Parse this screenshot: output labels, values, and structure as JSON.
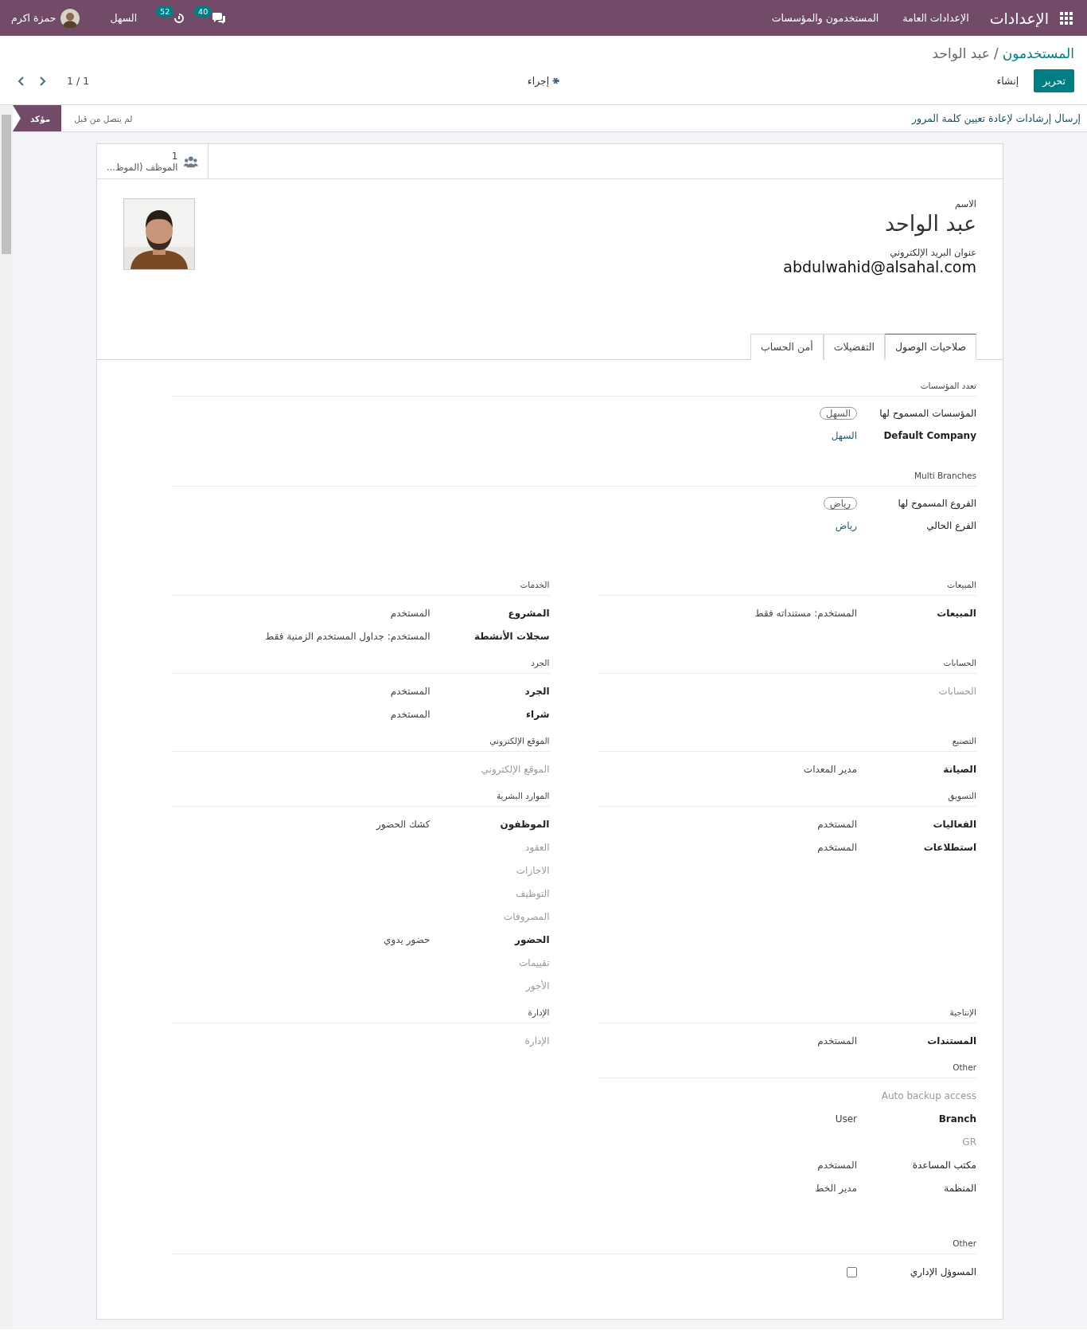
{
  "navbar": {
    "app_title": "الإعدادات",
    "menu": [
      "الإعدادات العامة",
      "المستخدمون والمؤسسات"
    ],
    "messages_count": "40",
    "activities_count": "52",
    "company": "السهل",
    "user": "حمزة اكرم"
  },
  "breadcrumb": {
    "parent": "المستخدمون",
    "separator": "/",
    "current": "عبد الواحد"
  },
  "buttons": [
    {
      "label": "تحرير",
      "kind": "primary"
    },
    {
      "label": "إنشاء",
      "kind": "secondary"
    }
  ],
  "action_menu": "إجراء",
  "pager": "1 / 1",
  "header_button": "إرسال إرشادات لإعادة تعيين كلمة المرور",
  "statuses": [
    {
      "label": "لم يتصل من قبل",
      "selected": false
    },
    {
      "label": "مؤكد",
      "selected": true
    }
  ],
  "smart_button": {
    "count": "1",
    "label": "الموظف (الموظ..."
  },
  "name_label": "الاسم",
  "name": "عبد الواحد",
  "email_label": "عنوان البريد الإلكتروني",
  "email": "abdulwahid@alsahal.com",
  "tabs": [
    {
      "label": "صلاحيات الوصول",
      "selected": true
    },
    {
      "label": "التفضيلات",
      "selected": false
    },
    {
      "label": "أمن الحساب",
      "selected": false
    }
  ],
  "company_groups": [
    {
      "title": "تعدد المؤسسات",
      "fields": [
        {
          "label": "المؤسسات المسموح لها",
          "kind": "tag",
          "value": "السهل",
          "bold": false
        },
        {
          "label": "Default Company",
          "kind": "link",
          "value": "السهل",
          "bold": true
        }
      ]
    },
    {
      "title": "Multi Branches",
      "fields": [
        {
          "label": "الفروع المسموح لها",
          "kind": "tag",
          "value": "رياض",
          "bold": false
        },
        {
          "label": "الفرع الحالي",
          "kind": "link",
          "value": "رياض",
          "bold": false
        }
      ]
    }
  ],
  "app_groups": [
    {
      "title": "المبيعات",
      "fields": [
        {
          "label": "المبيعات",
          "kind": "text",
          "value": "المستخدم: مستنداته فقط",
          "bold": true
        }
      ]
    },
    {
      "title": "الخدمات",
      "fields": [
        {
          "label": "المشروع",
          "kind": "text",
          "value": "المستخدم",
          "bold": true
        },
        {
          "label": "سجلات الأنشطة",
          "kind": "text",
          "value": "المستخدم: جداول المستخدم الزمنية فقط",
          "bold": true
        }
      ]
    },
    {
      "title": "الحسابات",
      "fields": [
        {
          "label": "الحسابات",
          "kind": "empty",
          "bold": false
        }
      ]
    },
    {
      "title": "الجرد",
      "fields": [
        {
          "label": "الجرد",
          "kind": "text",
          "value": "المستخدم",
          "bold": true
        },
        {
          "label": "شراء",
          "kind": "text",
          "value": "المستخدم",
          "bold": true
        }
      ]
    },
    {
      "title": "التصنيع",
      "fields": [
        {
          "label": "الصيانة",
          "kind": "text",
          "value": "مدير المعدات",
          "bold": true
        }
      ]
    },
    {
      "title": "الموقع الإلكتروني",
      "fields": [
        {
          "label": "الموقع الإلكتروني",
          "kind": "empty",
          "bold": false
        }
      ]
    },
    {
      "title": "التسويق",
      "fields": [
        {
          "label": "الفعاليات",
          "kind": "text",
          "value": "المستخدم",
          "bold": true
        },
        {
          "label": "استطلاعات",
          "kind": "text",
          "value": "المستخدم",
          "bold": true
        }
      ]
    },
    {
      "title": "الموارد البشرية",
      "fields": [
        {
          "label": "الموظفون",
          "kind": "text",
          "value": "كشك الحضور",
          "bold": true
        },
        {
          "label": "العقود",
          "kind": "empty",
          "bold": false
        },
        {
          "label": "الاجازات",
          "kind": "empty",
          "bold": false
        },
        {
          "label": "التوظيف",
          "kind": "empty",
          "bold": false
        },
        {
          "label": "المصروفات",
          "kind": "empty",
          "bold": false
        },
        {
          "label": "الحضور",
          "kind": "text",
          "value": "حضور يدوي",
          "bold": true
        },
        {
          "label": "تقييمات",
          "kind": "empty",
          "bold": false
        },
        {
          "label": "الأجور",
          "kind": "empty",
          "bold": false
        }
      ]
    },
    {
      "title": "الإنتاجية",
      "fields": [
        {
          "label": "المستندات",
          "kind": "text",
          "value": "المستخدم",
          "bold": true
        }
      ]
    },
    {
      "title": "الإدارة",
      "fields": [
        {
          "label": "الإدارة",
          "kind": "empty",
          "bold": false
        }
      ]
    },
    {
      "title": "Other",
      "fields": [
        {
          "label": "Auto backup access",
          "kind": "empty",
          "bold": false
        },
        {
          "label": "Branch",
          "kind": "text",
          "value": "User",
          "bold": true
        },
        {
          "label": "GR",
          "kind": "empty",
          "bold": false
        },
        {
          "label": "مكتب المساعدة",
          "kind": "text",
          "value": "المستخدم",
          "bold": false
        },
        {
          "label": "المنظمة",
          "kind": "text",
          "value": "مدير الخط",
          "bold": false
        }
      ]
    }
  ],
  "other_group": {
    "title": "Other",
    "fields": [
      {
        "label": "المسوؤل الإداري",
        "kind": "checkbox",
        "checked": false,
        "bold": false
      }
    ]
  }
}
